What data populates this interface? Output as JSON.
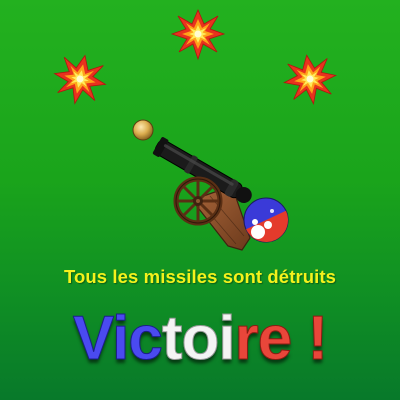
{
  "game": {
    "status_message": "Tous les missiles sont détruits",
    "victory_text_blue": "Vic",
    "victory_text_white": "toi",
    "victory_text_red": "re !"
  },
  "icons": {
    "explosions": [
      "explosion-icon",
      "explosion-icon",
      "explosion-icon"
    ],
    "projectile": "cannonball-icon",
    "player": "cannon-icon",
    "ammo_indicator": "ammo-ball-icon"
  },
  "colors": {
    "background_top": "#23b11f",
    "background_bottom": "#08792a",
    "status_text": "#f4f21c",
    "flag_blue": "#3a3ad8",
    "flag_white": "#ffffff",
    "flag_red": "#e43b2c",
    "explosion_outer": "#e8321e",
    "explosion_inner": "#ffe34a"
  }
}
